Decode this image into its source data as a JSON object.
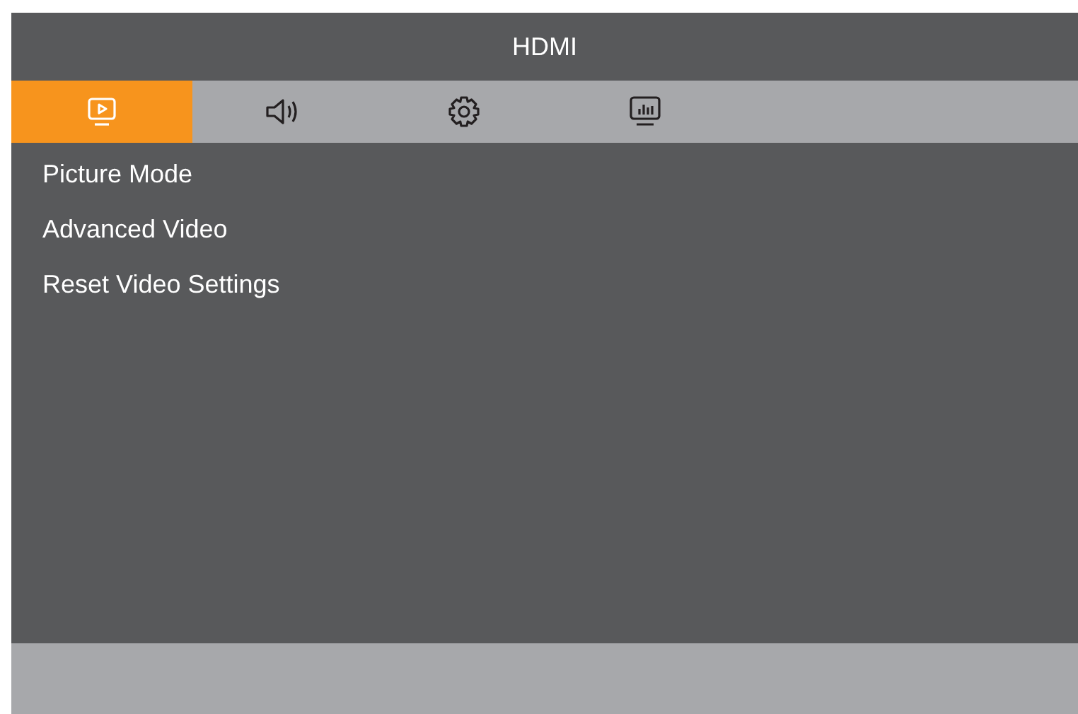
{
  "window": {
    "title": "HDMI"
  },
  "tabs": [
    {
      "kind": "picture",
      "selected": true
    },
    {
      "kind": "sound",
      "selected": false
    },
    {
      "kind": "settings",
      "selected": false
    },
    {
      "kind": "display",
      "selected": false
    }
  ],
  "menu": {
    "items": [
      {
        "label": "Picture Mode"
      },
      {
        "label": "Advanced Video"
      },
      {
        "label": "Reset Video Settings"
      }
    ]
  }
}
